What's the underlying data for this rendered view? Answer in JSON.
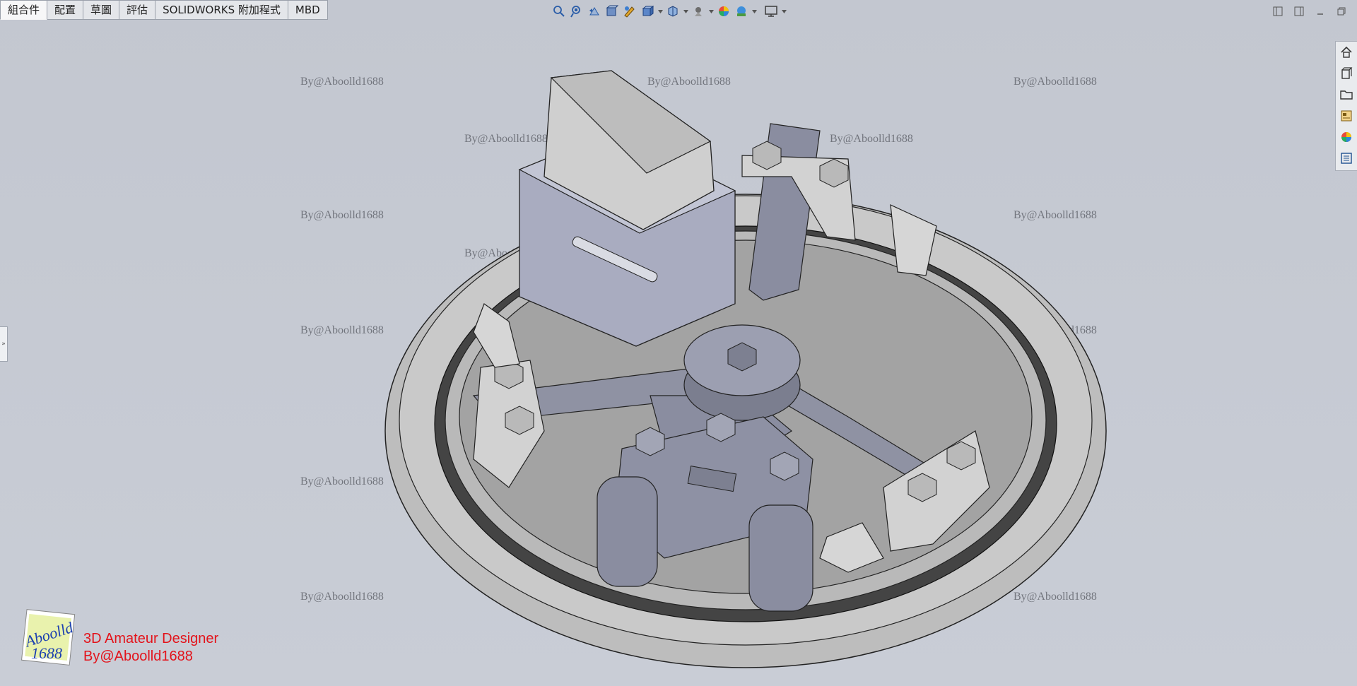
{
  "tabs": [
    "組合件",
    "配置",
    "草圖",
    "評估",
    "SOLIDWORKS 附加程式",
    "MBD"
  ],
  "active_tab": "組合件",
  "hud_icons": [
    "zoom-to-fit-icon",
    "zoom-to-area-icon",
    "previous-view-icon",
    "section-view-icon",
    "dynamic-annotation-icon",
    "view-orientation-icon",
    "display-style-icon",
    "hide-show-items-icon",
    "edit-appearance-icon",
    "apply-scene-icon",
    "view-settings-icon"
  ],
  "task_pane_icons": [
    "home-icon",
    "design-library-icon",
    "file-explorer-icon",
    "view-palette-icon",
    "appearances-icon",
    "custom-properties-icon"
  ],
  "watermark": "By@Aboolld1688",
  "brand": {
    "logo_text_top": "Aboolld",
    "logo_text_bottom": "1688",
    "line1": "3D Amateur Designer",
    "line2": "By@Aboolld1688"
  }
}
